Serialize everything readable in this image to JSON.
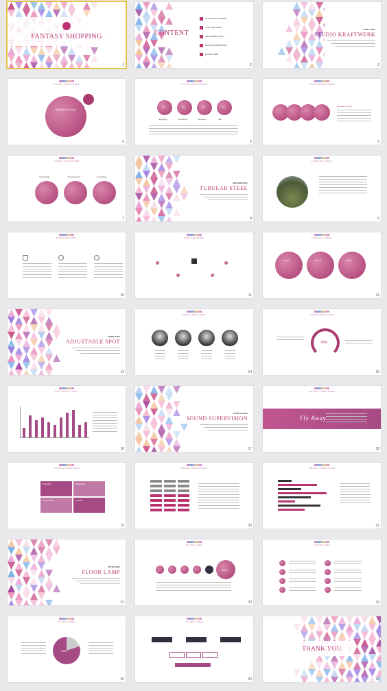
{
  "colors": {
    "accent": "#b8336f",
    "selection": "#e5c14a",
    "pink": "#d9669b",
    "blue": "#7fa8e0",
    "peach": "#f2c89b",
    "purple": "#a27bd8"
  },
  "slides": [
    {
      "n": "1",
      "title": "FANTASY SHOPPING",
      "icon": "twitter-bird-icon"
    },
    {
      "n": "2",
      "title": "CONTENT",
      "items": [
        "STUDIO KRAFTWERK",
        "TUBULAR STEEL",
        "ADJUSTABLE SPOT",
        "SOUND SUPERVISION",
        "FLOOR LAMP"
      ]
    },
    {
      "n": "3",
      "part": "FIRST PART",
      "title": "STUDIO KRAFTWERK"
    },
    {
      "n": "4",
      "header": "STUDIO KRAFTWERK",
      "circle": "Question of Day"
    },
    {
      "n": "5",
      "header": "STUDIO KRAFTWERK",
      "circles": [
        "01",
        "02",
        "03",
        "73"
      ],
      "labels": [
        "Shopping",
        "Developer",
        "Designer",
        "Seo"
      ]
    },
    {
      "n": "6",
      "header": "STUDIO KRAFTWERK",
      "side": "Question of Day"
    },
    {
      "n": "7",
      "header": "STUDIO KRAFTWERK",
      "labels": [
        "Community",
        "Development",
        "Consulting"
      ]
    },
    {
      "n": "8",
      "part": "SECOND PART",
      "title": "TUBULAR STEEL"
    },
    {
      "n": "9",
      "header": "TUBULAR STEEL"
    },
    {
      "n": "10",
      "header": "TUBULAR STEEL"
    },
    {
      "n": "11",
      "header": "TUBULAR STEEL"
    },
    {
      "n": "12",
      "header": "TUBULAR STEEL",
      "labels": [
        "Loyalty",
        "Winner",
        "Apple"
      ]
    },
    {
      "n": "13",
      "part": "THIRD PART",
      "title": "ADJUSTABLE SPOT"
    },
    {
      "n": "14",
      "header": "ADJUSTABLE SPOT"
    },
    {
      "n": "15",
      "header": "ADJUSTABLE SPOT",
      "pct": "78%"
    },
    {
      "n": "16",
      "header": "ADJUSTABLE SPOT"
    },
    {
      "n": "17",
      "part": "FOURTH PART",
      "title": "SOUND SUPERVISION"
    },
    {
      "n": "18",
      "header": "SOUND SUPERVISION",
      "band": "Fly Away"
    },
    {
      "n": "19",
      "header": "SOUND SUPERVISION",
      "cells": [
        "Strengths",
        "Weakness",
        "Opportunity",
        "Threats"
      ]
    },
    {
      "n": "20",
      "header": "SOUND SUPERVISION"
    },
    {
      "n": "21",
      "header": "SOUND SUPERVISION"
    },
    {
      "n": "22",
      "part": "FIFTH PART",
      "title": "FLOOR LAMP"
    },
    {
      "n": "23",
      "header": "FLOOR LAMP",
      "year": "2014"
    },
    {
      "n": "24",
      "header": "FLOOR LAMP"
    },
    {
      "n": "25",
      "header": "FLOOR LAMP",
      "pct": "20%"
    },
    {
      "n": "26",
      "header": "FLOOR LAMP"
    },
    {
      "n": "27",
      "title": "THANK YOU"
    }
  ]
}
